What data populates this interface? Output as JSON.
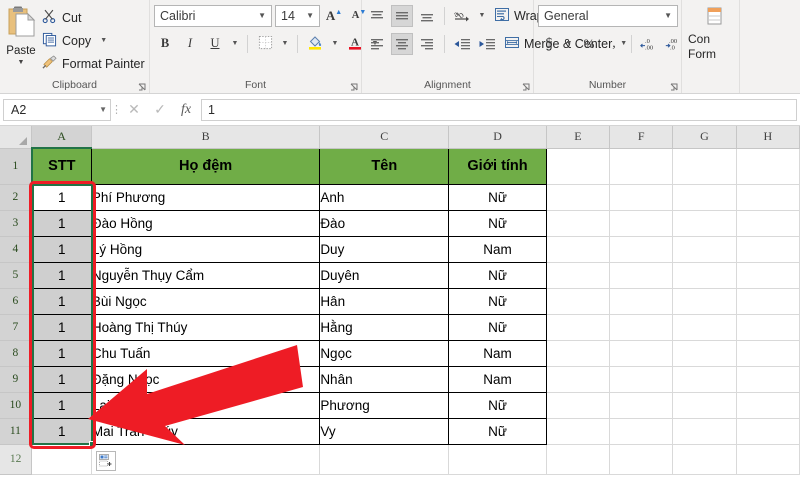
{
  "ribbon": {
    "clipboard": {
      "group_label": "Clipboard",
      "paste_label": "Paste",
      "items": [
        {
          "label": "Cut",
          "icon": "scissors-icon",
          "has_caret": false
        },
        {
          "label": "Copy",
          "icon": "copy-icon",
          "has_caret": true
        },
        {
          "label": "Format Painter",
          "icon": "format-painter-icon",
          "has_caret": false
        }
      ]
    },
    "font": {
      "group_label": "Font",
      "font_name": "Calibri",
      "font_size": "14",
      "grow_font": "A",
      "shrink_font": "A",
      "bold": "B",
      "italic": "I",
      "underline": "U"
    },
    "alignment": {
      "group_label": "Alignment",
      "wrap_text": "Wrap Text",
      "merge_center": "Merge & Center"
    },
    "number": {
      "group_label": "Number",
      "format": "General",
      "currency": "$",
      "percent": "%",
      "comma": ","
    },
    "conditional": {
      "line1": "Con",
      "line2": "Form"
    }
  },
  "formula_bar": {
    "name_box": "A2",
    "cancel_icon": "cancel-icon",
    "confirm_icon": "confirm-icon",
    "fx_icon": "fx-icon",
    "formula_value": "1"
  },
  "sheet": {
    "column_headers": [
      "A",
      "B",
      "C",
      "D",
      "E",
      "F",
      "G",
      "H"
    ],
    "row_headers": [
      "1",
      "2",
      "3",
      "4",
      "5",
      "6",
      "7",
      "8",
      "9",
      "10",
      "11",
      "12"
    ],
    "selected_column": "A",
    "table_headers": [
      "STT",
      "Họ đệm",
      "Tên",
      "Giới tính"
    ],
    "rows": [
      {
        "stt": "1",
        "ho_dem": "Phí Phương",
        "ten": "Anh",
        "gioi_tinh": "Nữ"
      },
      {
        "stt": "1",
        "ho_dem": "Đào Hồng",
        "ten": "Đào",
        "gioi_tinh": "Nữ"
      },
      {
        "stt": "1",
        "ho_dem": "Lý Hồng",
        "ten": "Duy",
        "gioi_tinh": "Nam"
      },
      {
        "stt": "1",
        "ho_dem": "Nguyễn Thụy Cẩm",
        "ten": "Duyên",
        "gioi_tinh": "Nữ"
      },
      {
        "stt": "1",
        "ho_dem": "Bùi Ngọc",
        "ten": "Hân",
        "gioi_tinh": "Nữ"
      },
      {
        "stt": "1",
        "ho_dem": "Hoàng Thị Thúy",
        "ten": "Hằng",
        "gioi_tinh": "Nữ"
      },
      {
        "stt": "1",
        "ho_dem": "Chu Tuấn",
        "ten": "Ngọc",
        "gioi_tinh": "Nam"
      },
      {
        "stt": "1",
        "ho_dem": "Đặng Ngọc",
        "ten": "Nhân",
        "gioi_tinh": "Nam"
      },
      {
        "stt": "1",
        "ho_dem": "Lại Thị Thanh",
        "ten": "Phương",
        "gioi_tinh": "Nữ"
      },
      {
        "stt": "1",
        "ho_dem": "Mai Trần Thúy",
        "ten": "Vy",
        "gioi_tinh": "Nữ"
      }
    ],
    "autofill_icon": "autofill-options-icon"
  },
  "annotation": {
    "highlight_box_color": "#ee1c25",
    "arrow_color": "#ee1c25",
    "selection_color": "#217346",
    "header_fill_color": "#70ad47"
  }
}
